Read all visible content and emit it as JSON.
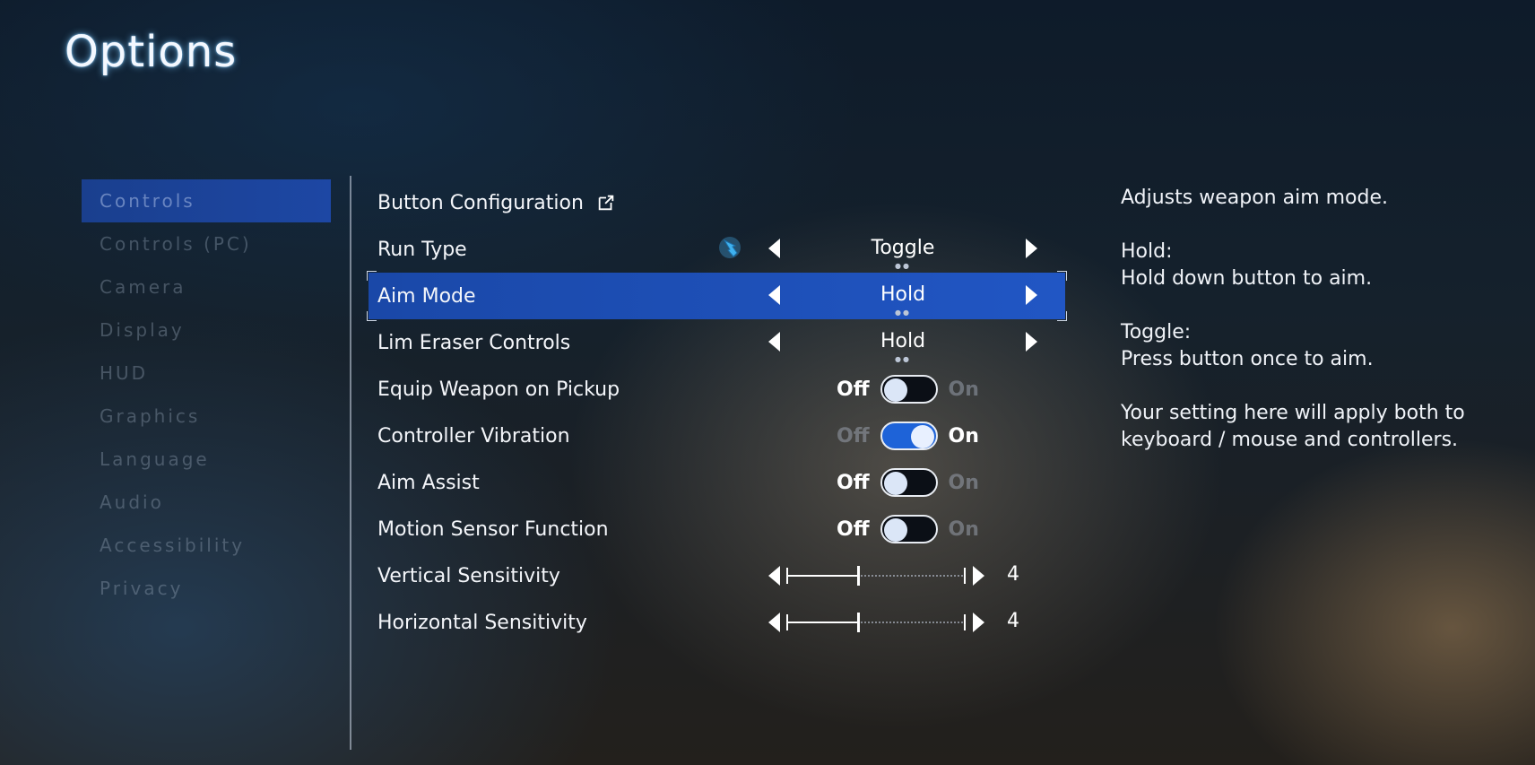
{
  "title": "Options",
  "sidebar": {
    "items": [
      {
        "label": "Controls"
      },
      {
        "label": "Controls (PC)"
      },
      {
        "label": "Camera"
      },
      {
        "label": "Display"
      },
      {
        "label": "HUD"
      },
      {
        "label": "Graphics"
      },
      {
        "label": "Language"
      },
      {
        "label": "Audio"
      },
      {
        "label": "Accessibility"
      },
      {
        "label": "Privacy"
      }
    ],
    "active": "Controls"
  },
  "settings": {
    "button_configuration": {
      "label": "Button Configuration",
      "icon": "external-link-icon"
    },
    "run_type": {
      "label": "Run Type",
      "value": "Toggle"
    },
    "aim_mode": {
      "label": "Aim Mode",
      "value": "Hold"
    },
    "lim_eraser": {
      "label": "Lim Eraser Controls",
      "value": "Hold"
    },
    "equip_weapon": {
      "label": "Equip Weapon on Pickup",
      "off": "Off",
      "on": "On",
      "state": "off"
    },
    "controller_vibration": {
      "label": "Controller Vibration",
      "off": "Off",
      "on": "On",
      "state": "on"
    },
    "aim_assist": {
      "label": "Aim Assist",
      "off": "Off",
      "on": "On",
      "state": "off"
    },
    "motion_sensor": {
      "label": "Motion Sensor Function",
      "off": "Off",
      "on": "On",
      "state": "off"
    },
    "vertical_sensitivity": {
      "label": "Vertical Sensitivity",
      "value": "4",
      "max": 10
    },
    "horizontal_sensitivity": {
      "label": "Horizontal Sensitivity",
      "value": "4",
      "max": 10
    }
  },
  "description": {
    "line1": "Adjusts weapon aim mode.",
    "hold_title": "Hold:",
    "hold_text": "Hold down button to aim.",
    "toggle_title": "Toggle:",
    "toggle_text": "Press button once to aim.",
    "note": "Your setting here will apply both to keyboard / mouse and controllers."
  },
  "colors": {
    "accent": "#1d47a4",
    "switch_on": "#1e63d8"
  }
}
